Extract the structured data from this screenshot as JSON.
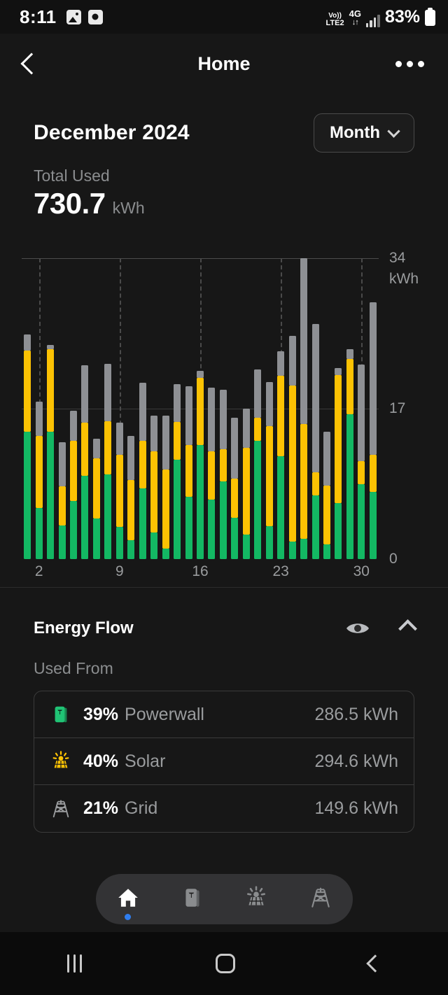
{
  "status_bar": {
    "time": "8:11",
    "icons": [
      "photo-icon",
      "clock-icon"
    ],
    "volte_top": "Vo))",
    "volte_bottom": "LTE2",
    "network": "4G",
    "data_arrows": "↓↑",
    "battery_percent": "83%"
  },
  "header": {
    "title": "Home",
    "back_icon": "back-chevron-icon",
    "overflow_icon": "more-options-icon"
  },
  "period": {
    "label": "December 2024",
    "selector_value": "Month",
    "selector_icon": "chevron-down-icon"
  },
  "summary": {
    "label": "Total Used",
    "value": "730.7",
    "unit": "kWh"
  },
  "chart_data": {
    "type": "bar",
    "title": "Total Used",
    "subtitle": "December 2024",
    "stacked": true,
    "xlabel": "",
    "ylabel": "kWh",
    "ylim": [
      0,
      34
    ],
    "yticks": [
      0,
      17,
      34
    ],
    "ytick_labels": [
      "0",
      "17",
      "34 kWh"
    ],
    "grid": "horizontal-and-dashed-vertical",
    "legend_position": "none",
    "x": [
      1,
      2,
      3,
      4,
      5,
      6,
      7,
      8,
      9,
      10,
      11,
      12,
      13,
      14,
      15,
      16,
      17,
      18,
      19,
      20,
      21,
      22,
      23,
      24,
      25,
      26,
      27,
      28,
      29,
      30,
      31
    ],
    "categories": [
      "1",
      "2",
      "3",
      "4",
      "5",
      "6",
      "7",
      "8",
      "9",
      "10",
      "11",
      "12",
      "13",
      "14",
      "15",
      "16",
      "17",
      "18",
      "19",
      "20",
      "21",
      "22",
      "23",
      "24",
      "25",
      "26",
      "27",
      "28",
      "29",
      "30",
      "31"
    ],
    "xtick_labels": [
      "2",
      "9",
      "16",
      "23",
      "30"
    ],
    "xtick_positions": [
      2,
      9,
      16,
      23,
      30
    ],
    "colors": {
      "powerwall": "#13b863",
      "solar": "#fcc203",
      "grid": "#8e9094"
    },
    "series": [
      {
        "name": "Powerwall",
        "color": "#13b863",
        "values": [
          14.4,
          5.8,
          14.4,
          3.8,
          6.6,
          9.4,
          4.6,
          9.6,
          3.6,
          2.1,
          8.0,
          3.0,
          1.2,
          11.2,
          7.0,
          12.9,
          6.7,
          8.8,
          4.7,
          2.8,
          13.4,
          3.7,
          11.6,
          2.0,
          2.3,
          7.2,
          1.7,
          6.3,
          16.4,
          8.5,
          7.6
        ]
      },
      {
        "name": "Solar",
        "color": "#fcc203",
        "values": [
          9.2,
          8.1,
          9.3,
          4.4,
          6.8,
          6.0,
          6.8,
          6.0,
          8.2,
          6.8,
          5.4,
          9.2,
          8.9,
          4.3,
          5.9,
          7.6,
          5.5,
          3.6,
          4.4,
          9.8,
          2.6,
          11.3,
          9.1,
          17.6,
          13.0,
          2.6,
          6.6,
          14.5,
          6.2,
          2.6,
          4.2
        ]
      },
      {
        "name": "Grid",
        "color": "#8e9094",
        "values": [
          1.8,
          3.9,
          0.5,
          5.0,
          3.4,
          6.5,
          2.2,
          6.5,
          3.6,
          5.0,
          6.5,
          4.0,
          6.1,
          4.3,
          6.6,
          0.8,
          7.2,
          6.7,
          6.9,
          4.4,
          5.4,
          5.0,
          2.8,
          5.6,
          18.7,
          16.8,
          6.1,
          0.8,
          1.1,
          10.9,
          17.2
        ]
      }
    ]
  },
  "energy_flow": {
    "title": "Energy Flow",
    "eye_icon": "eye-icon",
    "collapse_icon": "chevron-up-icon",
    "section_label": "Used From",
    "rows": [
      {
        "icon": "powerwall-icon",
        "percent": "39%",
        "name": "Powerwall",
        "energy": "286.5 kWh"
      },
      {
        "icon": "solar-icon",
        "percent": "40%",
        "name": "Solar",
        "energy": "294.6 kWh"
      },
      {
        "icon": "grid-icon",
        "percent": "21%",
        "name": "Grid",
        "energy": "149.6 kWh"
      }
    ]
  },
  "tabbar": {
    "tabs": [
      {
        "icon": "home-icon",
        "name": "Home",
        "selected": true
      },
      {
        "icon": "powerwall-icon",
        "name": "Powerwall",
        "selected": false
      },
      {
        "icon": "solar-icon",
        "name": "Solar",
        "selected": false
      },
      {
        "icon": "grid-icon",
        "name": "Grid",
        "selected": false
      }
    ]
  },
  "android_nav": {
    "recents": "recents-icon",
    "home": "home-square-icon",
    "back": "back-icon"
  }
}
